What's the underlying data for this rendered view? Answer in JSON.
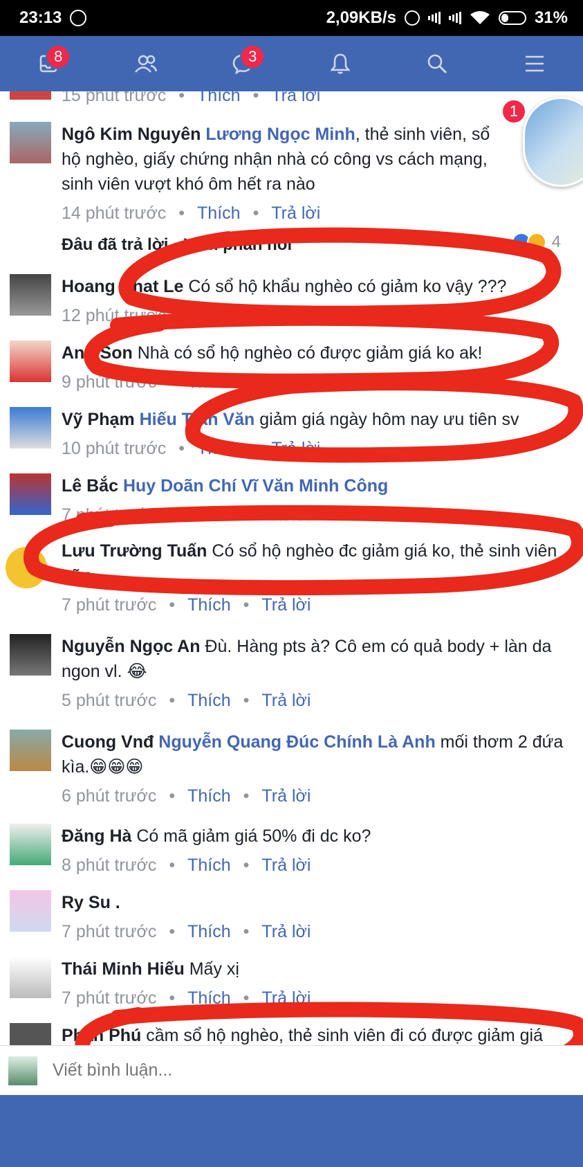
{
  "status_bar": {
    "time": "23:13",
    "net_speed": "2,09KB/s",
    "battery": "31%",
    "icons": [
      "messenger-icon",
      "alarm-icon",
      "signal-icon",
      "signal-icon",
      "wifi-icon",
      "battery-icon"
    ]
  },
  "navbar": {
    "items": [
      {
        "icon": "friend-requests-icon",
        "badge": "8"
      },
      {
        "icon": "friends-icon",
        "badge": ""
      },
      {
        "icon": "messages-icon",
        "badge": "3"
      },
      {
        "icon": "notifications-icon",
        "badge": ""
      },
      {
        "icon": "search-icon",
        "badge": ""
      },
      {
        "icon": "menu-icon",
        "badge": ""
      }
    ],
    "color": "#4267b2"
  },
  "chat_head": {
    "badge": "1"
  },
  "labels": {
    "like": "Thích",
    "reply": "Trả lời",
    "dot": "•"
  },
  "comments": [
    {
      "author": "",
      "mention": "",
      "text": "",
      "time": "15 phút trước",
      "reactions": ""
    },
    {
      "author": "Ngô Kim Nguyên",
      "mention": "Lương Ngọc Minh",
      "text": ", thẻ sinh viên, sổ hộ nghèo, giấy chứng nhận nhà có công vs cách mạng, sinh viên vượt khó ôm hết ra nào",
      "time": "14 phút trước",
      "reactions": "4"
    },
    {
      "author": "Hoang Nhat Le",
      "mention": "",
      "text": "Có sổ hộ khẩu nghèo có giảm ko vậy ???",
      "time": "12 phút trước",
      "reactions": ""
    },
    {
      "author": "Anh Son",
      "mention": "",
      "text": "Nhà có sổ hộ nghèo có được giảm giá ko ak!",
      "time": "9 phút trước",
      "reactions": ""
    },
    {
      "author": "Vỹ Phạm",
      "mention": "Hiếu Trần Văn",
      "text": "giảm giá ngày hôm nay ưu tiên sv",
      "time": "10 phút trước",
      "reactions": ""
    },
    {
      "author": "Lê Bắc",
      "mention": "Huy Doãn Chí Vĩ Văn Minh Công",
      "text": "",
      "time": "7 phút trước",
      "reactions": ""
    },
    {
      "author": "Lưu Trường Tuấn",
      "mention": "",
      "text": "Có sổ hộ nghèo đc giảm giá ko, thẻ sinh viên nữa",
      "time": "7 phút trước",
      "reactions": ""
    },
    {
      "author": "Nguyễn Ngọc An",
      "mention": "",
      "text": "Đù. Hàng pts à? Cô em có quả body + làn da ngon vl. 😂",
      "time": "5 phút trước",
      "reactions": ""
    },
    {
      "author": "Cuong Vnđ",
      "mention": "Nguyễn Quang Đúc Chính Là Anh",
      "text": "mối thơm 2 đứa kìa.😁😁😁",
      "time": "6 phút trước",
      "reactions": ""
    },
    {
      "author": "Đăng Hà",
      "mention": "",
      "text": "Có mã giảm giá 50% đi dc ko?",
      "time": "8 phút trước",
      "reactions": ""
    },
    {
      "author": "Ry Su .",
      "mention": "",
      "text": "",
      "time": "7 phút trước",
      "reactions": ""
    },
    {
      "author": "Thái Minh Hiếu",
      "mention": "",
      "text": "Mấy xị",
      "time": "7 phút trước",
      "reactions": ""
    },
    {
      "author": "Phan Phú",
      "mention": "",
      "text": "cầm sổ hộ nghèo, thẻ sinh viên đi có được giảm giá",
      "time": "",
      "reactions": ""
    }
  ],
  "section_label": "Đâu đã trả lời · Xem phản hồi",
  "composer": {
    "placeholder": "Viết bình luận..."
  },
  "annotation_color": "#e8291b"
}
